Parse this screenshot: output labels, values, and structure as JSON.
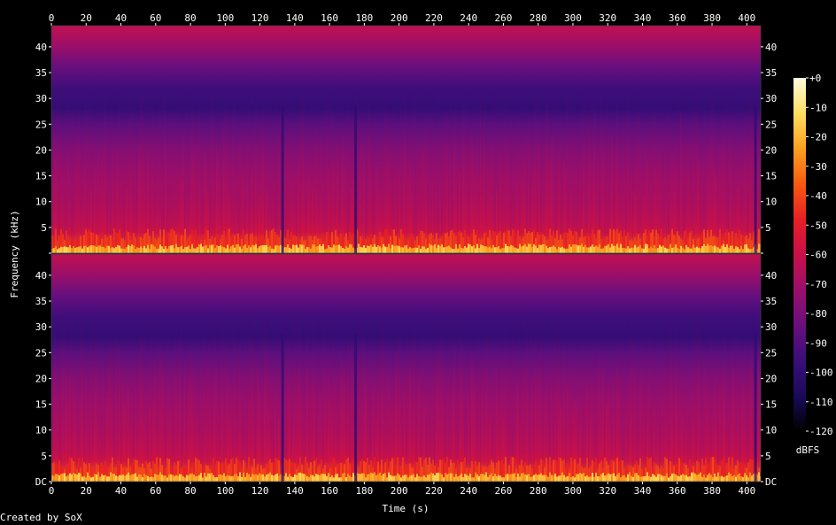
{
  "chart_data": {
    "type": "heatmap",
    "title": "",
    "xlabel": "Time (s)",
    "ylabel": "Frequency (kHz)",
    "xlim": [
      0,
      408
    ],
    "x_ticks": [
      0,
      20,
      40,
      60,
      80,
      100,
      120,
      140,
      160,
      180,
      200,
      220,
      240,
      260,
      280,
      300,
      320,
      340,
      360,
      380,
      400
    ],
    "channels": [
      {
        "name": "",
        "ylim": [
          0,
          44.1
        ],
        "y_tick_values": [
          0,
          5,
          10,
          15,
          20,
          25,
          30,
          35,
          40
        ],
        "y_tick_labels": [
          "",
          "5",
          "10",
          "15",
          "20",
          "25",
          "30",
          "35",
          "40"
        ]
      },
      {
        "name": "",
        "ylim": [
          0,
          44.1
        ],
        "y_tick_values": [
          0,
          5,
          10,
          15,
          20,
          25,
          30,
          35,
          40
        ],
        "y_tick_labels": [
          "DC",
          "5",
          "10",
          "15",
          "20",
          "25",
          "30",
          "35",
          "40"
        ]
      }
    ],
    "colorbar": {
      "label": "dBFS",
      "range": [
        -120,
        0
      ],
      "tick_values": [
        0,
        -10,
        -20,
        -30,
        -40,
        -50,
        -60,
        -70,
        -80,
        -90,
        -100,
        -110,
        -120
      ],
      "tick_labels": [
        "+0",
        "-10",
        "-20",
        "-30",
        "-40",
        "-50",
        "-60",
        "-70",
        "-80",
        "-90",
        "-100",
        "-110",
        "-120"
      ],
      "colors": [
        "#000000",
        "#1a0a5a",
        "#3a0e7a",
        "#6a0f7e",
        "#9a0f6a",
        "#c8104a",
        "#e81f24",
        "#f85a10",
        "#fca020",
        "#fde060",
        "#fffbe0"
      ]
    },
    "spectral_profile": {
      "description_units": "dBFS by frequency (kHz), typical level",
      "freq_khz": [
        0,
        1,
        2,
        4,
        6,
        10,
        15,
        20,
        25,
        28,
        32,
        36,
        40,
        44
      ],
      "level_dbfs": [
        -25,
        -30,
        -40,
        -55,
        -62,
        -68,
        -72,
        -78,
        -88,
        -98,
        -95,
        -85,
        -72,
        -62
      ]
    },
    "silent_moments_s": [
      133,
      175,
      405
    ]
  },
  "footer": {
    "credit": "Created by SoX"
  }
}
